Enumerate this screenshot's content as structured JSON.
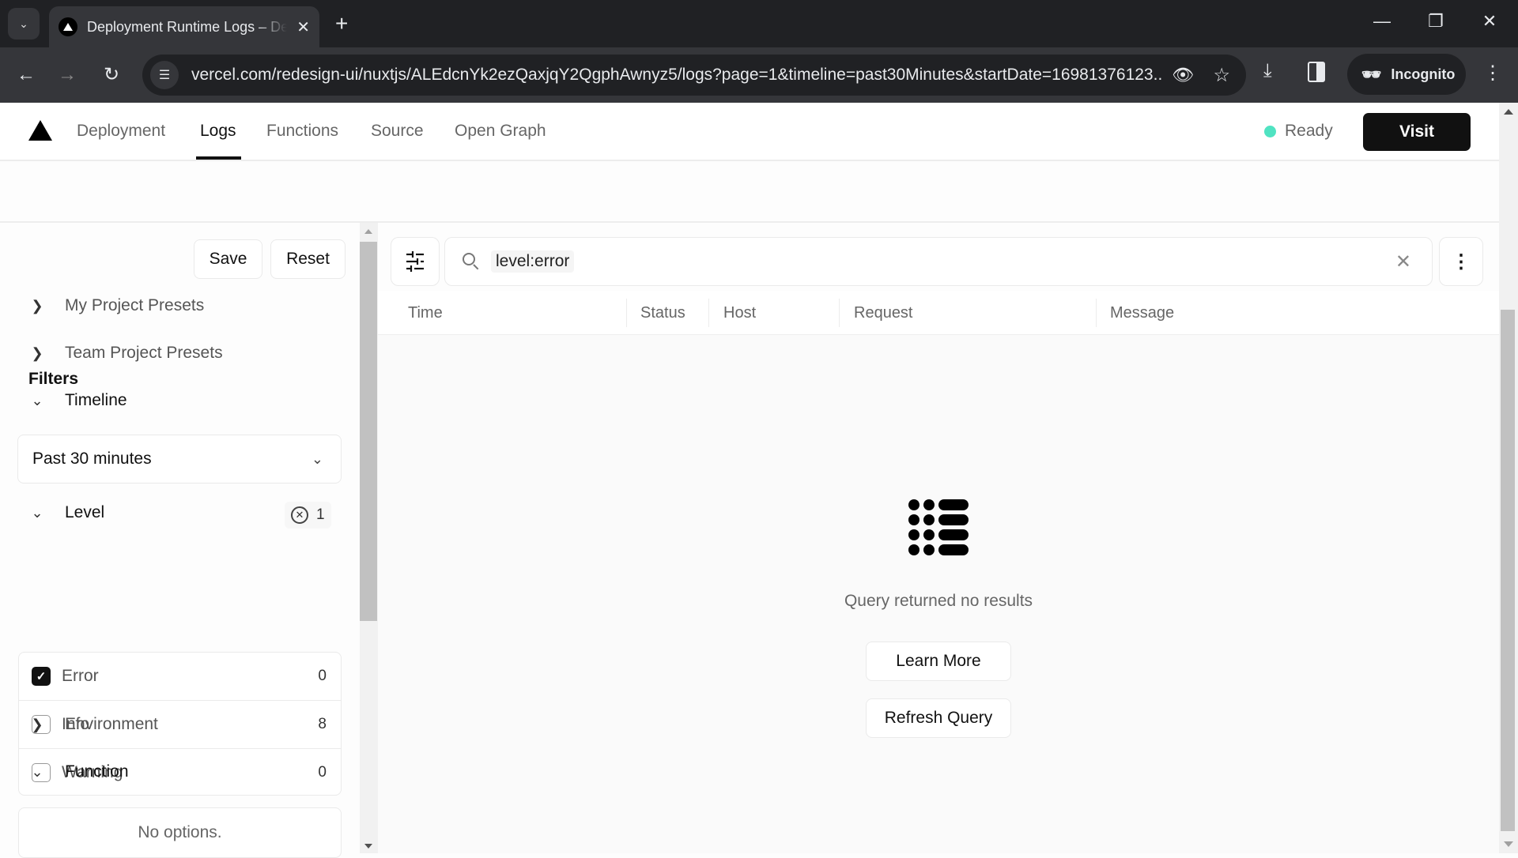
{
  "browser": {
    "tab_title": "Deployment Runtime Logs – Deployment",
    "url": "vercel.com/redesign-ui/nuxtjs/ALEdcnYk2ezQaxjqY2QgphAwnyz5/logs?page=1&timeline=past30Minutes&startDate=16981376123...",
    "profile_label": "Incognito"
  },
  "nav": {
    "tabs": [
      {
        "label": "Deployment",
        "active": false
      },
      {
        "label": "Logs",
        "active": true
      },
      {
        "label": "Functions",
        "active": false
      },
      {
        "label": "Source",
        "active": false
      },
      {
        "label": "Open Graph",
        "active": false
      }
    ],
    "status": "Ready",
    "status_color": "#50e3c2",
    "visit_label": "Visit"
  },
  "sidebar": {
    "title": "Filters",
    "save_label": "Save",
    "reset_label": "Reset",
    "sections": {
      "my_presets": "My Project Presets",
      "team_presets": "Team Project Presets",
      "timeline": "Timeline",
      "level": "Level",
      "environment": "Environment",
      "function": "Function"
    },
    "timeline_value": "Past 30 minutes",
    "level_active_count": "1",
    "levels": [
      {
        "label": "Error",
        "count": "0",
        "checked": true
      },
      {
        "label": "Info",
        "count": "8",
        "checked": false
      },
      {
        "label": "Warning",
        "count": "0",
        "checked": false
      }
    ],
    "function_empty": "No options."
  },
  "main": {
    "search_value": "level:error",
    "columns": [
      "Time",
      "Status",
      "Host",
      "Request",
      "Message"
    ],
    "empty_message": "Query returned no results",
    "learn_more_label": "Learn More",
    "refresh_label": "Refresh Query"
  }
}
